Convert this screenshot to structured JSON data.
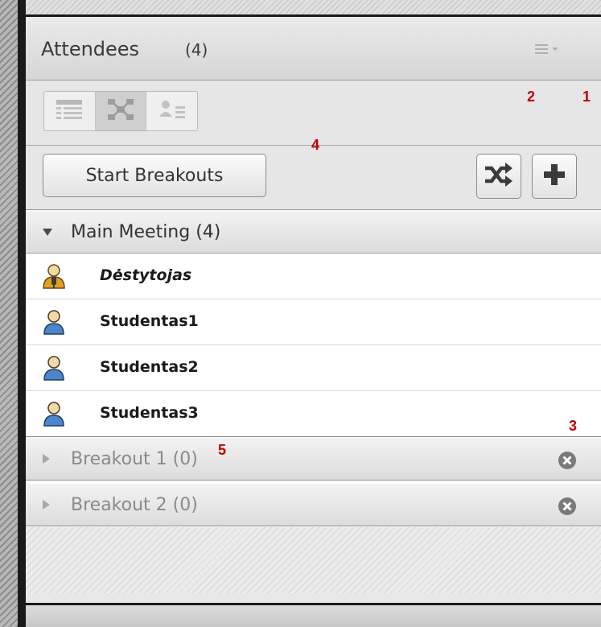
{
  "panel": {
    "title": "Attendees",
    "count": "(4)",
    "menu_icon": "hamburger-dropdown-icon"
  },
  "view_buttons": [
    {
      "icon": "list-view-icon",
      "active": false
    },
    {
      "icon": "breakout-view-icon",
      "active": true
    },
    {
      "icon": "role-view-icon",
      "active": false
    }
  ],
  "actions": {
    "start_breakouts_label": "Start Breakouts",
    "shuffle_icon": "shuffle-icon",
    "add_icon": "plus-icon"
  },
  "main_meeting": {
    "label": "Main Meeting (4)",
    "expanded": true,
    "attendees": [
      {
        "name": "Dėstytojas",
        "role": "host",
        "icon": "presenter-icon"
      },
      {
        "name": "Studentas1",
        "role": "participant",
        "icon": "participant-icon"
      },
      {
        "name": "Studentas2",
        "role": "participant",
        "icon": "participant-icon"
      },
      {
        "name": "Studentas3",
        "role": "participant",
        "icon": "participant-icon"
      }
    ]
  },
  "breakouts": [
    {
      "label": "Breakout 1 (0)",
      "expanded": false
    },
    {
      "label": "Breakout 2 (0)",
      "expanded": false
    }
  ],
  "annotations": [
    "1",
    "2",
    "3",
    "4",
    "5"
  ],
  "colors": {
    "annotation": "#c00000",
    "participant_icon": "#4a86c8",
    "host_icon": "#e0a020"
  }
}
